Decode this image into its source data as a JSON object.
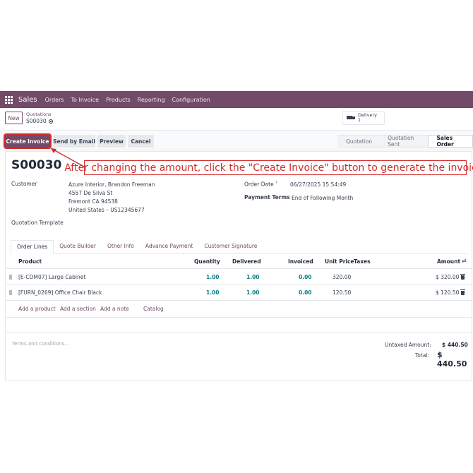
{
  "navbar": {
    "app_name": "Sales",
    "menu": [
      "Orders",
      "To Invoice",
      "Products",
      "Reporting",
      "Configuration"
    ]
  },
  "control": {
    "new_label": "New",
    "breadcrumb_parent": "Quotations",
    "breadcrumb_current": "S00030",
    "delivery_label": "Delivery",
    "delivery_count": "1"
  },
  "actions": {
    "create_invoice": "Create Invoice",
    "send_by_email": "Send by Email",
    "preview": "Preview",
    "cancel": "Cancel"
  },
  "status": [
    "Quotation",
    "Quotation Sent",
    "Sales Order"
  ],
  "annotation": "After changing the amount, click the \"Create Invoice\" button to generate the invoice.",
  "form": {
    "name": "S00030",
    "customer_label": "Customer",
    "customer_name": "Azure Interior, Brandon Freeman",
    "address_lines": [
      "4557 De Silva St",
      "Fremont CA 94538",
      "United States – US12345677"
    ],
    "order_date_label": "Order Date",
    "order_date_help": "?",
    "order_date": "06/27/2025 15:54:49",
    "payment_terms_label": "Payment Terms",
    "payment_terms": "End of Following Month",
    "quotation_template_label": "Quotation Template"
  },
  "tabs": [
    "Order Lines",
    "Quote Builder",
    "Other Info",
    "Advance Payment",
    "Customer Signature"
  ],
  "table": {
    "headers": {
      "product": "Product",
      "quantity": "Quantity",
      "delivered": "Delivered",
      "invoiced": "Invoiced",
      "unit_price": "Unit Price",
      "taxes": "Taxes",
      "amount": "Amount"
    },
    "rows": [
      {
        "product": "[E-COM07] Large Cabinet",
        "quantity": "1.00",
        "delivered": "1.00",
        "invoiced": "0.00",
        "unit_price": "320.00",
        "amount": "$ 320.00"
      },
      {
        "product": "[FURN_0269] Office Chair Black",
        "quantity": "1.00",
        "delivered": "1.00",
        "invoiced": "0.00",
        "unit_price": "120.50",
        "amount": "$ 120.50"
      }
    ],
    "add_links": [
      "Add a product",
      "Add a section",
      "Add a note",
      "Catalog"
    ]
  },
  "footer": {
    "terms_placeholder": "Terms and conditions...",
    "untaxed_label": "Untaxed Amount:",
    "untaxed_value": "$ 440.50",
    "total_label": "Total:",
    "total_value": "$ 440.50"
  },
  "colors": {
    "brand": "#714b67",
    "link": "#017e84",
    "annotation": "#d12d2d"
  }
}
